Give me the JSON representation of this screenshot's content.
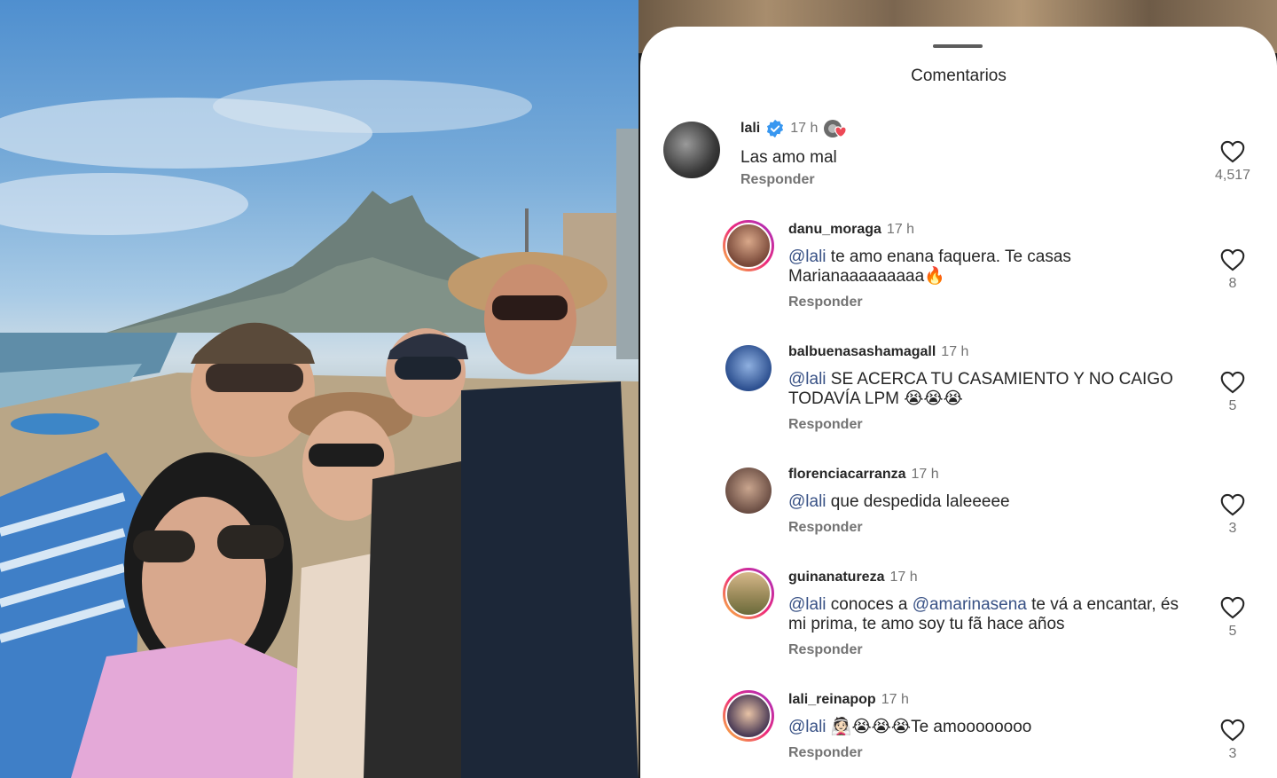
{
  "sheet": {
    "title": "Comentarios"
  },
  "comments": [
    {
      "username": "lali",
      "time": "17 h",
      "text": "Las amo mal",
      "reply_label": "Responder",
      "likes": "4,517",
      "verified": true,
      "liked_by_author": true
    },
    {
      "username": "danu_moraga",
      "time": "17 h",
      "mention": "@lali",
      "text_line1": " te amo enana faquera. Te casas",
      "text_line2": "Marianaaaaaaaaa🔥",
      "reply_label": "Responder",
      "likes": "8"
    },
    {
      "username": "balbuenasashamagall",
      "time": "17 h",
      "mention": "@lali",
      "text_line1": " SE ACERCA TU CASAMIENTO Y NO CAIGO",
      "text_line2": "TODAVÍA LPM 😭😭😭",
      "reply_label": "Responder",
      "likes": "5"
    },
    {
      "username": "florenciacarranza",
      "time": "17 h",
      "mention": "@lali",
      "text_line1": " que despedida laleeeee",
      "reply_label": "Responder",
      "likes": "3"
    },
    {
      "username": "guinanatureza",
      "time": "17 h",
      "mention": "@lali",
      "text_mid": " conoces a ",
      "mention2": "@amarinasena",
      "text_end": " te vá a encantar, és",
      "text_line2": "mi prima, te amo soy tu fã hace años",
      "reply_label": "Responder",
      "likes": "5"
    },
    {
      "username": "lali_reinapop",
      "time": "17 h",
      "mention": "@lali",
      "text_line1": " 👰🏻😭😭😭Te amoooooooo",
      "reply_label": "Responder",
      "likes": "3"
    }
  ],
  "icons": {
    "heart": "heart-outline-icon",
    "verified": "verified-badge-icon"
  },
  "colors": {
    "mention": "#385185",
    "verified": "#3897f0",
    "muted": "#737373",
    "text": "#262626"
  }
}
